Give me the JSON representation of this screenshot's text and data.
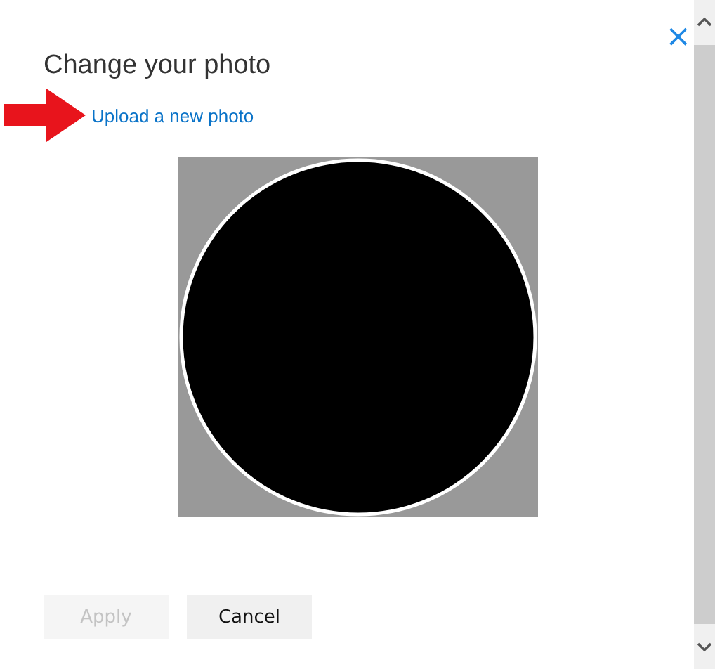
{
  "dialog": {
    "title": "Change your photo",
    "close": "×",
    "link": "Upload a new photo",
    "buttons": [
      {
        "label": "Apply",
        "disabled": true
      },
      {
        "label": "Cancel",
        "disabled": false
      }
    ]
  }
}
